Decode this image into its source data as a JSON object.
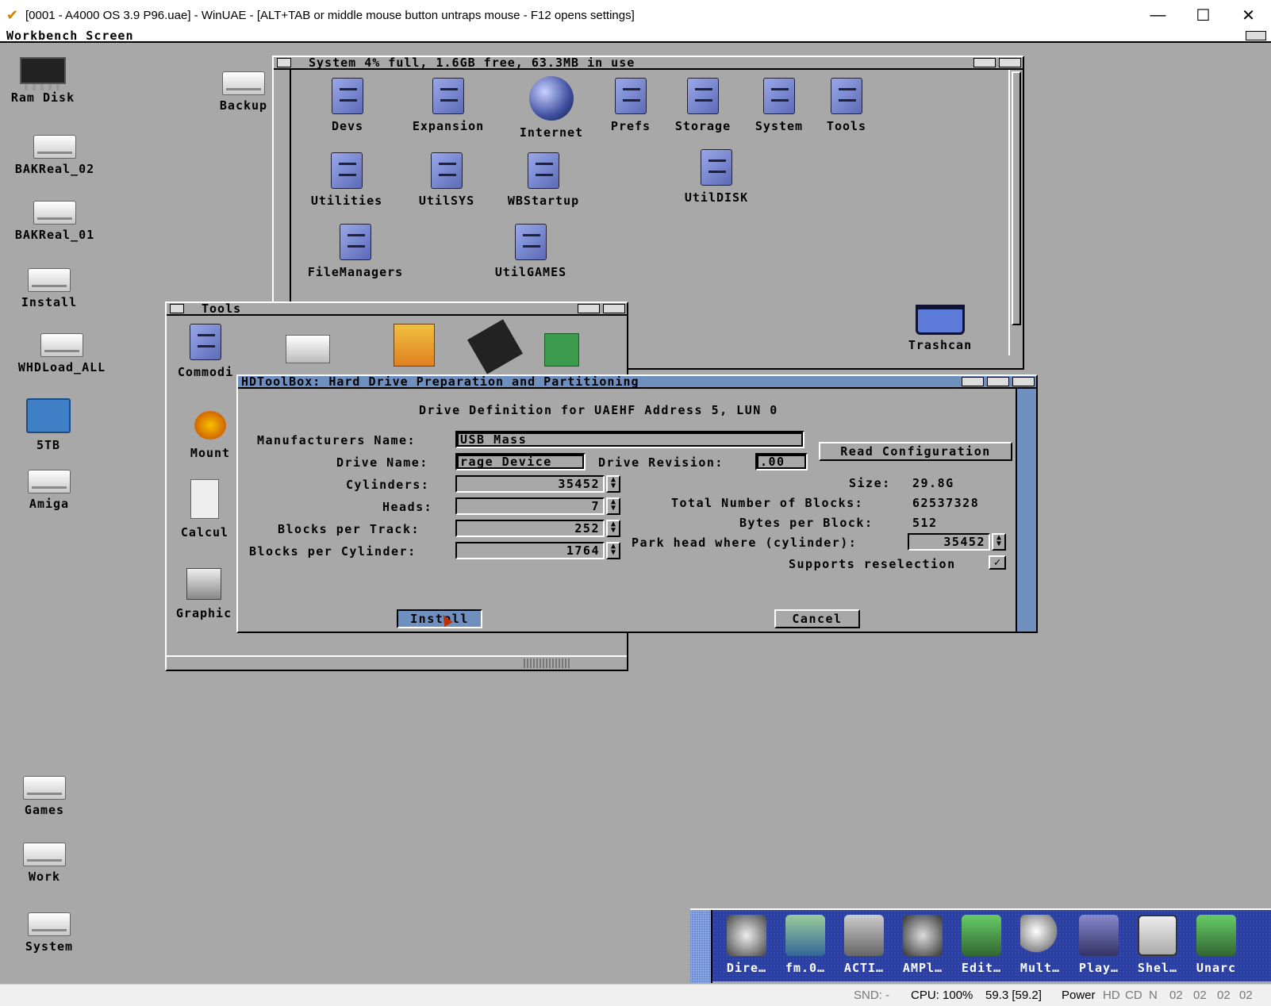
{
  "window": {
    "title": "[0001 - A4000 OS 3.9 P96.uae] - WinUAE - [ALT+TAB or middle mouse button untraps mouse - F12 opens settings]",
    "minimize": "—",
    "maximize": "☐",
    "close": "✕"
  },
  "screen": {
    "title": "Workbench Screen"
  },
  "desktop_icons": {
    "ram": "Ram Disk",
    "bak02": "BAKReal_02",
    "bak01": "BAKReal_01",
    "install": "Install",
    "whd": "WHDLoad_ALL",
    "tb5": "5TB",
    "amiga": "Amiga",
    "backup": "Backup",
    "games": "Games",
    "work": "Work",
    "system": "System",
    "trashcan": "Trashcan"
  },
  "system_window": {
    "title": "System  4% full, 1.6GB free, 63.3MB in use",
    "items": [
      "Devs",
      "Expansion",
      "Internet",
      "Prefs",
      "Storage",
      "System",
      "Tools",
      "Utilities",
      "UtilSYS",
      "WBStartup",
      "UtilDISK",
      "FileManagers",
      "UtilGAMES"
    ]
  },
  "tools_window": {
    "title": "Tools",
    "items": [
      "Commodi",
      "Mount",
      "Calcul",
      "Graphic"
    ]
  },
  "dialog": {
    "title": "HDToolBox: Hard Drive Preparation and Partitioning",
    "heading": "Drive Definition for UAEHF Address 5, LUN 0",
    "manufacturer_label": "Manufacturers Name:",
    "manufacturer_value": "USB Mass",
    "drive_name_label": "Drive Name:",
    "drive_name_value": "rage Device",
    "drive_rev_label": "Drive Revision:",
    "drive_rev_value": ".00",
    "read_config": "Read Configuration",
    "cylinders_label": "Cylinders:",
    "cylinders_value": "35452",
    "heads_label": "Heads:",
    "heads_value": "7",
    "bpt_label": "Blocks per Track:",
    "bpt_value": "252",
    "bpc_label": "Blocks per Cylinder:",
    "bpc_value": "1764",
    "size_label": "Size:",
    "size_value": "29.8G",
    "total_label": "Total Number of Blocks:",
    "total_value": "62537328",
    "bytes_label": "Bytes per Block:",
    "bytes_value": "512",
    "park_label": "Park head where (cylinder):",
    "park_value": "35452",
    "reselect_label": "Supports reselection",
    "reselect_checked": true,
    "install": "Install",
    "cancel": "Cancel"
  },
  "dock": {
    "items": [
      "Dire…",
      "fm.0…",
      "ACTI…",
      "AMPl…",
      "Edit…",
      "Mult…",
      "Play…",
      "Shel…",
      "Unarc"
    ]
  },
  "status": {
    "snd": "SND: -",
    "cpu": "CPU: 100%",
    "fps": "59.3 [59.2]",
    "power": "Power",
    "hd": "HD",
    "cd": "CD",
    "n": "N",
    "d0": "02",
    "d1": "02",
    "d2": "02",
    "d3": "02"
  }
}
